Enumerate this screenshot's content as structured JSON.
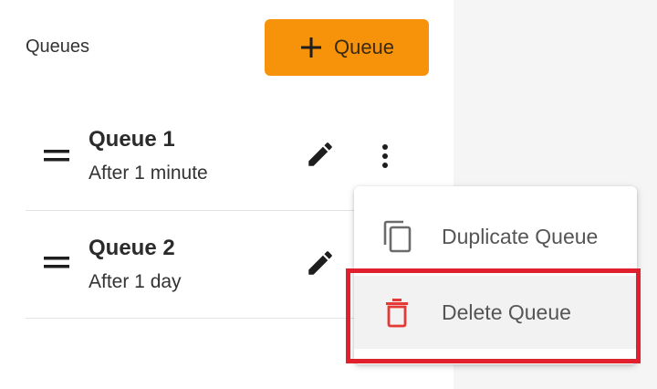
{
  "header": {
    "title": "Queues",
    "add_button_label": "Queue",
    "add_button_icon": "plus-icon",
    "accent_color": "#f7930a"
  },
  "queues": [
    {
      "name": "Queue 1",
      "schedule": "After 1 minute"
    },
    {
      "name": "Queue 2",
      "schedule": "After 1 day"
    }
  ],
  "context_menu": {
    "items": [
      {
        "label": "Duplicate Queue",
        "icon": "copy-icon"
      },
      {
        "label": "Delete Queue",
        "icon": "trash-icon",
        "color": "#e53935"
      }
    ]
  },
  "annotation": {
    "highlight_color": "#e0202c",
    "highlighted_item": "Delete Queue"
  }
}
